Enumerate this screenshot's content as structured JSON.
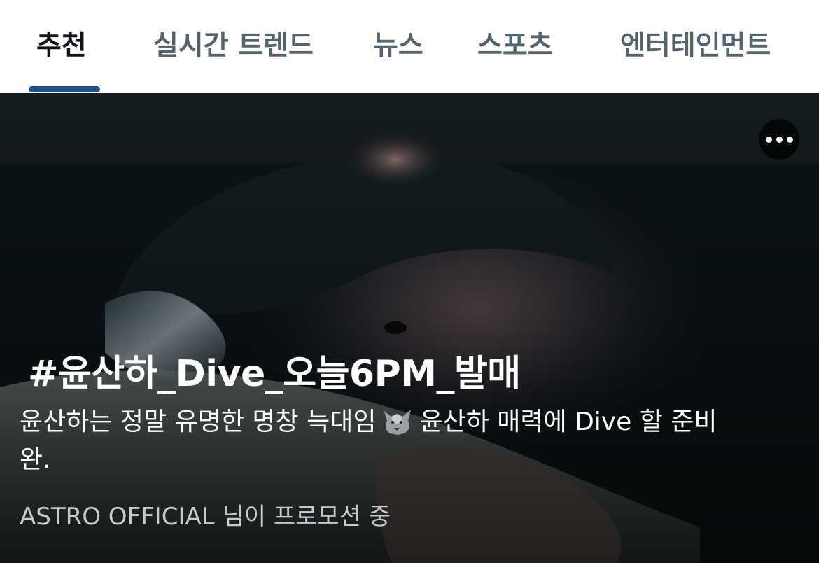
{
  "tabs": [
    {
      "label": "추천",
      "active": true
    },
    {
      "label": "실시간 트렌드",
      "active": false
    },
    {
      "label": "뉴스",
      "active": false
    },
    {
      "label": "스포츠",
      "active": false
    },
    {
      "label": "엔터테인먼트",
      "active": false
    }
  ],
  "colors": {
    "active_tab": "#0f1419",
    "inactive_tab": "#53646f",
    "indicator": "#1d4f91",
    "promo_text": "#c5cacd"
  },
  "hero": {
    "headline": "#윤산하_Dive_오늘6PM_발매",
    "description_part1": "윤산하는 정말 유명한 명창 늑대임",
    "description_icon": "wolf-emoji",
    "description_part2": "윤산하 매력에 Dive 할 준비완.",
    "promoted_by": "ASTRO OFFICIAL 님이 프로모션 중",
    "more_icon": "more-horizontal-icon"
  }
}
